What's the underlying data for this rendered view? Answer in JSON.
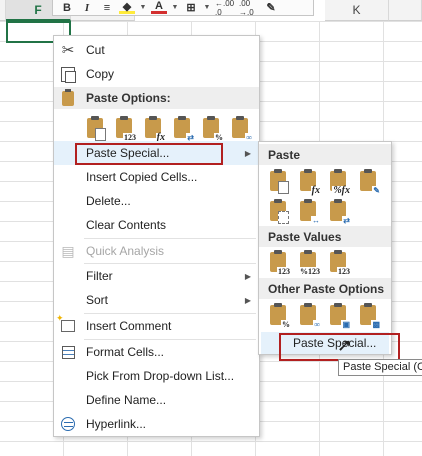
{
  "sheet": {
    "columns": [
      "F",
      "K"
    ],
    "selected_column": "F"
  },
  "minibar": {
    "items": [
      "bold-icon",
      "italic-icon",
      "align-icon",
      "fill-color-icon",
      "font-color-icon",
      "borders-icon",
      "increase-decimal-icon",
      "decrease-decimal-icon",
      "format-painter-icon"
    ],
    "bold": "B",
    "italic": "I",
    "font_color": "A",
    "increase_decimal": "←.00 .0",
    "decrease_decimal": ".00 →.0"
  },
  "context_menu": {
    "cut": "Cut",
    "copy": "Copy",
    "paste_options_header": "Paste Options:",
    "paste_options": [
      {
        "icon": "paste-icon",
        "label": ""
      },
      {
        "icon": "paste-values-icon",
        "label": "123"
      },
      {
        "icon": "paste-formulas-icon",
        "label": "fx"
      },
      {
        "icon": "paste-transpose-icon",
        "label": ""
      },
      {
        "icon": "paste-formatting-icon",
        "label": "%"
      },
      {
        "icon": "paste-link-icon",
        "label": ""
      }
    ],
    "paste_special": "Paste Special...",
    "insert_copied_cells": "Insert Copied Cells...",
    "delete": "Delete...",
    "clear_contents": "Clear Contents",
    "quick_analysis": "Quick Analysis",
    "filter": "Filter",
    "sort": "Sort",
    "insert_comment": "Insert Comment",
    "format_cells": "Format Cells...",
    "pick_from_dropdown": "Pick From Drop-down List...",
    "define_name": "Define Name...",
    "hyperlink": "Hyperlink..."
  },
  "submenu": {
    "paste_header": "Paste",
    "paste_row1": [
      {
        "icon": "paste-icon",
        "label": ""
      },
      {
        "icon": "paste-formulas-icon",
        "label": "fx"
      },
      {
        "icon": "paste-formulas-number-format-icon",
        "label": "%fx"
      },
      {
        "icon": "paste-keep-source-formatting-icon",
        "label": ""
      }
    ],
    "paste_row2": [
      {
        "icon": "paste-no-borders-icon",
        "label": ""
      },
      {
        "icon": "paste-keep-column-widths-icon",
        "label": ""
      },
      {
        "icon": "paste-transpose-icon",
        "label": ""
      }
    ],
    "paste_values_header": "Paste Values",
    "paste_values_row": [
      {
        "icon": "paste-values-icon",
        "label": "123"
      },
      {
        "icon": "paste-values-number-format-icon",
        "label": "%123"
      },
      {
        "icon": "paste-values-source-format-icon",
        "label": "123"
      }
    ],
    "other_header": "Other Paste Options",
    "other_row": [
      {
        "icon": "paste-formatting-icon",
        "label": "%"
      },
      {
        "icon": "paste-link-icon",
        "label": ""
      },
      {
        "icon": "paste-picture-icon",
        "label": ""
      },
      {
        "icon": "paste-linked-picture-icon",
        "label": ""
      }
    ],
    "paste_special": "Paste Special..."
  },
  "tooltip": "Paste Special (C"
}
